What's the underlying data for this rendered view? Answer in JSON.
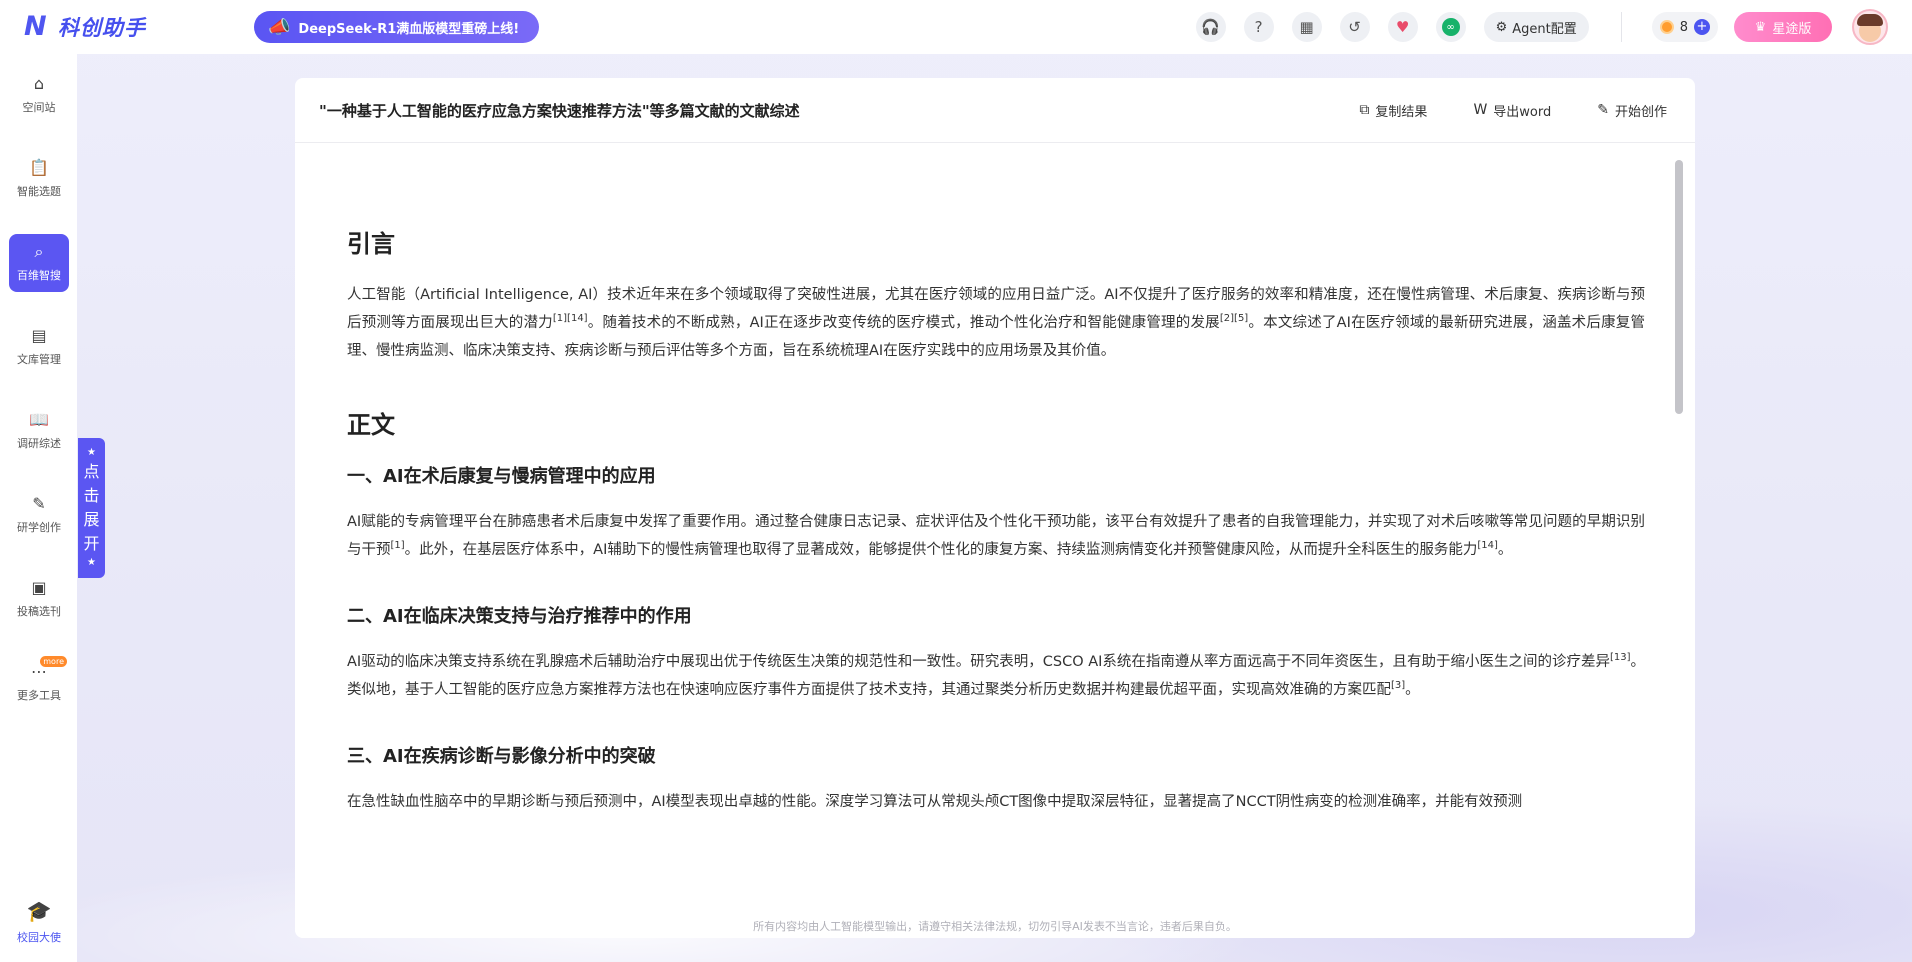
{
  "app": {
    "logo_text": "科创助手",
    "promo_text": "DeepSeek-R1满血版模型重磅上线!"
  },
  "topbar": {
    "agent_label": "Agent配置",
    "coins": "8",
    "vip_label": "星途版"
  },
  "sidebar": {
    "items": [
      {
        "label": "空间站",
        "icon": "home-icon"
      },
      {
        "label": "智能选题",
        "icon": "clipboard-icon"
      },
      {
        "label": "百维智搜",
        "icon": "search-robot-icon"
      },
      {
        "label": "文库管理",
        "icon": "library-icon"
      },
      {
        "label": "调研综述",
        "icon": "book-icon"
      },
      {
        "label": "研学创作",
        "icon": "edit-icon"
      },
      {
        "label": "投稿选刊",
        "icon": "journal-icon"
      },
      {
        "label": "更多工具",
        "icon": "more-icon"
      }
    ],
    "more_badge": "more",
    "bottom_label": "校园大使"
  },
  "expand_tab": {
    "label": "点击展开"
  },
  "card": {
    "title": "\"一种基于人工智能的医疗应急方案快速推荐方法\"等多篇文献的文献综述",
    "actions": {
      "copy": "复制结果",
      "export": "导出word",
      "create": "开始创作"
    }
  },
  "article": {
    "intro_heading": "引言",
    "intro_p1": "人工智能（Artificial Intelligence, AI）技术近年来在多个领域取得了突破性进展，尤其在医疗领域的应用日益广泛。AI不仅提升了医疗服务的效率和精准度，还在慢性病管理、术后康复、疾病诊断与预后预测等方面展现出巨大的潜力",
    "intro_ref1": "[1][14]",
    "intro_p2": "。随着技术的不断成熟，AI正在逐步改变传统的医疗模式，推动个性化治疗和智能健康管理的发展",
    "intro_ref2": "[2][5]",
    "intro_p3": "。本文综述了AI在医疗领域的最新研究进展，涵盖术后康复管理、慢性病监测、临床决策支持、疾病诊断与预后评估等多个方面，旨在系统梳理AI在医疗实践中的应用场景及其价值。",
    "body_heading": "正文",
    "s1_heading": "一、AI在术后康复与慢病管理中的应用",
    "s1_p1": "AI赋能的专病管理平台在肺癌患者术后康复中发挥了重要作用。通过整合健康日志记录、症状评估及个性化干预功能，该平台有效提升了患者的自我管理能力，并实现了对术后咳嗽等常见问题的早期识别与干预",
    "s1_ref1": "[1]",
    "s1_p2": "。此外，在基层医疗体系中，AI辅助下的慢性病管理也取得了显著成效，能够提供个性化的康复方案、持续监测病情变化并预警健康风险，从而提升全科医生的服务能力",
    "s1_ref2": "[14]",
    "s1_p3": "。",
    "s2_heading": "二、AI在临床决策支持与治疗推荐中的作用",
    "s2_p1": "AI驱动的临床决策支持系统在乳腺癌术后辅助治疗中展现出优于传统医生决策的规范性和一致性。研究表明，CSCO AI系统在指南遵从率方面远高于不同年资医生，且有助于缩小医生之间的诊疗差异",
    "s2_ref1": "[13]",
    "s2_p2": "。类似地，基于人工智能的医疗应急方案推荐方法也在快速响应医疗事件方面提供了技术支持，其通过聚类分析历史数据并构建最优超平面，实现高效准确的方案匹配",
    "s2_ref2": "[3]",
    "s2_p3": "。",
    "s3_heading": "三、AI在疾病诊断与影像分析中的突破",
    "s3_p1": "在急性缺血性脑卒中的早期诊断与预后预测中，AI模型表现出卓越的性能。深度学习算法可从常规头颅CT图像中提取深层特征，显著提高了NCCT阴性病变的检测准确率，并能有效预测"
  },
  "footer": {
    "disclaimer": "所有内容均由人工智能模型输出，请遵守相关法律法规，切勿引导AI发表不当言论，违者后果自负。"
  }
}
